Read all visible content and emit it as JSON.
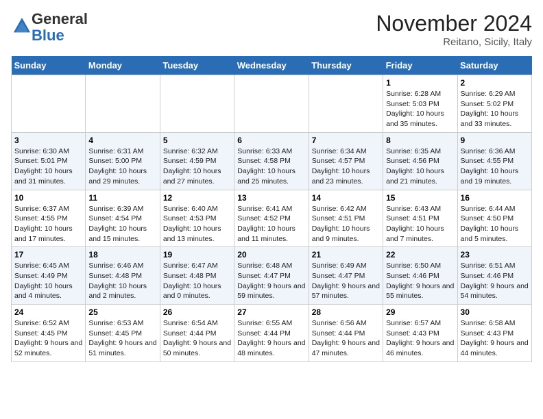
{
  "header": {
    "logo_general": "General",
    "logo_blue": "Blue",
    "month_title": "November 2024",
    "location": "Reitano, Sicily, Italy"
  },
  "days_of_week": [
    "Sunday",
    "Monday",
    "Tuesday",
    "Wednesday",
    "Thursday",
    "Friday",
    "Saturday"
  ],
  "weeks": [
    [
      null,
      null,
      null,
      null,
      null,
      {
        "day": "1",
        "sunrise": "Sunrise: 6:28 AM",
        "sunset": "Sunset: 5:03 PM",
        "daylight": "Daylight: 10 hours and 35 minutes."
      },
      {
        "day": "2",
        "sunrise": "Sunrise: 6:29 AM",
        "sunset": "Sunset: 5:02 PM",
        "daylight": "Daylight: 10 hours and 33 minutes."
      }
    ],
    [
      {
        "day": "3",
        "sunrise": "Sunrise: 6:30 AM",
        "sunset": "Sunset: 5:01 PM",
        "daylight": "Daylight: 10 hours and 31 minutes."
      },
      {
        "day": "4",
        "sunrise": "Sunrise: 6:31 AM",
        "sunset": "Sunset: 5:00 PM",
        "daylight": "Daylight: 10 hours and 29 minutes."
      },
      {
        "day": "5",
        "sunrise": "Sunrise: 6:32 AM",
        "sunset": "Sunset: 4:59 PM",
        "daylight": "Daylight: 10 hours and 27 minutes."
      },
      {
        "day": "6",
        "sunrise": "Sunrise: 6:33 AM",
        "sunset": "Sunset: 4:58 PM",
        "daylight": "Daylight: 10 hours and 25 minutes."
      },
      {
        "day": "7",
        "sunrise": "Sunrise: 6:34 AM",
        "sunset": "Sunset: 4:57 PM",
        "daylight": "Daylight: 10 hours and 23 minutes."
      },
      {
        "day": "8",
        "sunrise": "Sunrise: 6:35 AM",
        "sunset": "Sunset: 4:56 PM",
        "daylight": "Daylight: 10 hours and 21 minutes."
      },
      {
        "day": "9",
        "sunrise": "Sunrise: 6:36 AM",
        "sunset": "Sunset: 4:55 PM",
        "daylight": "Daylight: 10 hours and 19 minutes."
      }
    ],
    [
      {
        "day": "10",
        "sunrise": "Sunrise: 6:37 AM",
        "sunset": "Sunset: 4:55 PM",
        "daylight": "Daylight: 10 hours and 17 minutes."
      },
      {
        "day": "11",
        "sunrise": "Sunrise: 6:39 AM",
        "sunset": "Sunset: 4:54 PM",
        "daylight": "Daylight: 10 hours and 15 minutes."
      },
      {
        "day": "12",
        "sunrise": "Sunrise: 6:40 AM",
        "sunset": "Sunset: 4:53 PM",
        "daylight": "Daylight: 10 hours and 13 minutes."
      },
      {
        "day": "13",
        "sunrise": "Sunrise: 6:41 AM",
        "sunset": "Sunset: 4:52 PM",
        "daylight": "Daylight: 10 hours and 11 minutes."
      },
      {
        "day": "14",
        "sunrise": "Sunrise: 6:42 AM",
        "sunset": "Sunset: 4:51 PM",
        "daylight": "Daylight: 10 hours and 9 minutes."
      },
      {
        "day": "15",
        "sunrise": "Sunrise: 6:43 AM",
        "sunset": "Sunset: 4:51 PM",
        "daylight": "Daylight: 10 hours and 7 minutes."
      },
      {
        "day": "16",
        "sunrise": "Sunrise: 6:44 AM",
        "sunset": "Sunset: 4:50 PM",
        "daylight": "Daylight: 10 hours and 5 minutes."
      }
    ],
    [
      {
        "day": "17",
        "sunrise": "Sunrise: 6:45 AM",
        "sunset": "Sunset: 4:49 PM",
        "daylight": "Daylight: 10 hours and 4 minutes."
      },
      {
        "day": "18",
        "sunrise": "Sunrise: 6:46 AM",
        "sunset": "Sunset: 4:48 PM",
        "daylight": "Daylight: 10 hours and 2 minutes."
      },
      {
        "day": "19",
        "sunrise": "Sunrise: 6:47 AM",
        "sunset": "Sunset: 4:48 PM",
        "daylight": "Daylight: 10 hours and 0 minutes."
      },
      {
        "day": "20",
        "sunrise": "Sunrise: 6:48 AM",
        "sunset": "Sunset: 4:47 PM",
        "daylight": "Daylight: 9 hours and 59 minutes."
      },
      {
        "day": "21",
        "sunrise": "Sunrise: 6:49 AM",
        "sunset": "Sunset: 4:47 PM",
        "daylight": "Daylight: 9 hours and 57 minutes."
      },
      {
        "day": "22",
        "sunrise": "Sunrise: 6:50 AM",
        "sunset": "Sunset: 4:46 PM",
        "daylight": "Daylight: 9 hours and 55 minutes."
      },
      {
        "day": "23",
        "sunrise": "Sunrise: 6:51 AM",
        "sunset": "Sunset: 4:46 PM",
        "daylight": "Daylight: 9 hours and 54 minutes."
      }
    ],
    [
      {
        "day": "24",
        "sunrise": "Sunrise: 6:52 AM",
        "sunset": "Sunset: 4:45 PM",
        "daylight": "Daylight: 9 hours and 52 minutes."
      },
      {
        "day": "25",
        "sunrise": "Sunrise: 6:53 AM",
        "sunset": "Sunset: 4:45 PM",
        "daylight": "Daylight: 9 hours and 51 minutes."
      },
      {
        "day": "26",
        "sunrise": "Sunrise: 6:54 AM",
        "sunset": "Sunset: 4:44 PM",
        "daylight": "Daylight: 9 hours and 50 minutes."
      },
      {
        "day": "27",
        "sunrise": "Sunrise: 6:55 AM",
        "sunset": "Sunset: 4:44 PM",
        "daylight": "Daylight: 9 hours and 48 minutes."
      },
      {
        "day": "28",
        "sunrise": "Sunrise: 6:56 AM",
        "sunset": "Sunset: 4:44 PM",
        "daylight": "Daylight: 9 hours and 47 minutes."
      },
      {
        "day": "29",
        "sunrise": "Sunrise: 6:57 AM",
        "sunset": "Sunset: 4:43 PM",
        "daylight": "Daylight: 9 hours and 46 minutes."
      },
      {
        "day": "30",
        "sunrise": "Sunrise: 6:58 AM",
        "sunset": "Sunset: 4:43 PM",
        "daylight": "Daylight: 9 hours and 44 minutes."
      }
    ]
  ]
}
